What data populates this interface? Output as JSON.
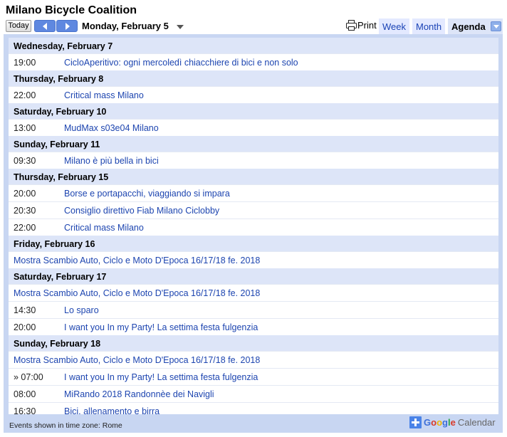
{
  "title": "Milano Bicycle Coalition",
  "nav": {
    "today_label": "Today",
    "date_label": "Monday, February 5",
    "print_label": "Print",
    "tabs": [
      "Week",
      "Month",
      "Agenda"
    ],
    "active_tab": "Agenda"
  },
  "agenda": [
    {
      "date": "Wednesday, February 7",
      "events": [
        {
          "time": "19:00",
          "title": "CicloAperitivo: ogni mercoledì chiacchiere di bici e non solo"
        }
      ]
    },
    {
      "date": "Thursday, February 8",
      "events": [
        {
          "time": "22:00",
          "title": "Critical mass Milano"
        }
      ]
    },
    {
      "date": "Saturday, February 10",
      "events": [
        {
          "time": "13:00",
          "title": "MudMax s03e04 Milano"
        }
      ]
    },
    {
      "date": "Sunday, February 11",
      "events": [
        {
          "time": "09:30",
          "title": "Milano è più bella in bici"
        }
      ]
    },
    {
      "date": "Thursday, February 15",
      "events": [
        {
          "time": "20:00",
          "title": "Borse e portapacchi, viaggiando si impara"
        },
        {
          "time": "20:30",
          "title": "Consiglio direttivo Fiab Milano Ciclobby"
        },
        {
          "time": "22:00",
          "title": "Critical mass Milano"
        }
      ]
    },
    {
      "date": "Friday, February 16",
      "events": [
        {
          "time": "",
          "title": "Mostra Scambio Auto, Ciclo e Moto D'Epoca 16/17/18 fe. 2018"
        }
      ]
    },
    {
      "date": "Saturday, February 17",
      "events": [
        {
          "time": "",
          "title": "Mostra Scambio Auto, Ciclo e Moto D'Epoca 16/17/18 fe. 2018"
        },
        {
          "time": "14:30",
          "title": "Lo sparo"
        },
        {
          "time": "20:00",
          "title": "I want you In my Party! La settima festa fulgenzia"
        }
      ]
    },
    {
      "date": "Sunday, February 18",
      "events": [
        {
          "time": "",
          "title": "Mostra Scambio Auto, Ciclo e Moto D'Epoca 16/17/18 fe. 2018"
        },
        {
          "time": "» 07:00",
          "title": "I want you In my Party! La settima festa fulgenzia"
        },
        {
          "time": "08:00",
          "title": "MiRando 2018 Randonnèe dei Navigli"
        },
        {
          "time": "16:30",
          "title": "Bici, allenamento e birra"
        }
      ]
    }
  ],
  "footer": {
    "timezone_text": "Events shown in time zone: Rome",
    "gcal_google": "Google",
    "gcal_calendar": "Calendar"
  },
  "colors": {
    "link": "#1d45b0",
    "panel": "#c8d6f2",
    "day_header": "#dde5f8",
    "nav_button": "#5f88e0"
  },
  "icons": [
    "chevron-left-icon",
    "chevron-right-icon",
    "caret-down-icon",
    "printer-icon",
    "add-plus-icon"
  ]
}
